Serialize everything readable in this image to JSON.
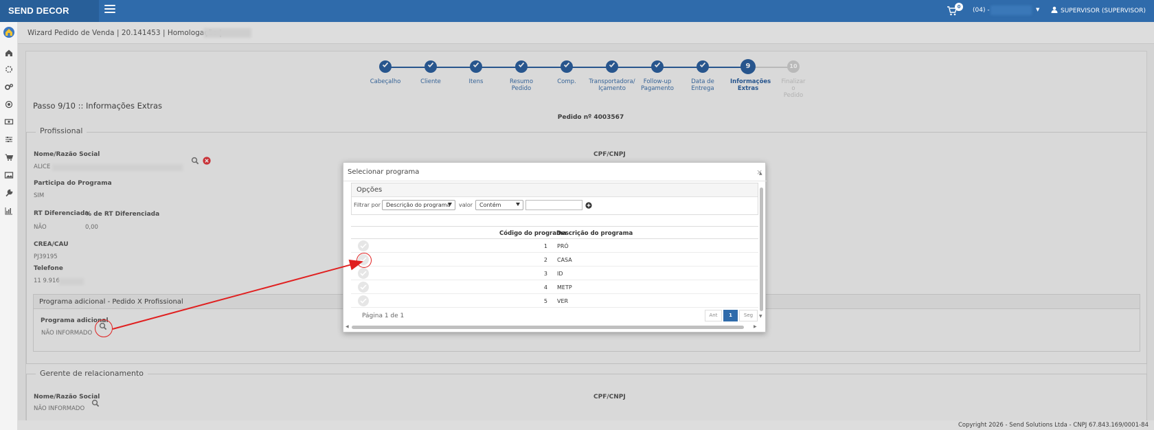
{
  "app": {
    "brand": "SEND DECOR"
  },
  "topbar": {
    "cart_count": "0",
    "store": "(04) -",
    "user": "SUPERVISOR (SUPERVISOR)"
  },
  "header": {
    "title": "Wizard Pedido de Venda | 20.141453 | Homologação |"
  },
  "wizard": {
    "steps": [
      {
        "label": "Cabeçalho",
        "num": ""
      },
      {
        "label": "Cliente",
        "num": ""
      },
      {
        "label": "Itens",
        "num": ""
      },
      {
        "label": "Resumo Pedido",
        "num": ""
      },
      {
        "label": "Comp.",
        "num": ""
      },
      {
        "label": "Transportadora/ Içamento",
        "num": ""
      },
      {
        "label": "Follow-up Pagamento",
        "num": ""
      },
      {
        "label": "Data de Entrega",
        "num": ""
      },
      {
        "label": "Informações Extras",
        "num": "9"
      },
      {
        "label": "Finalizar o Pedido",
        "num": "10"
      }
    ]
  },
  "page": {
    "passo": "Passo 9/10 :: Informações Extras",
    "pedido": "Pedido nº 4003567"
  },
  "profissional": {
    "legend": "Profissional",
    "nome_label": "Nome/Razão Social",
    "nome_value": "ALICE",
    "cpf_label": "CPF/CNPJ",
    "participa_label": "Participa do Programa",
    "participa_value": "SIM",
    "rt_label": "RT Diferenciada",
    "rt_value": "NÃO",
    "pct_rt_label": "% de RT Diferenciada",
    "pct_rt_value": "0,00",
    "crea_label": "CREA/CAU",
    "crea_value": "PJ39195",
    "telefone_label": "Telefone",
    "telefone_value": "11 9.916"
  },
  "programa_adicional": {
    "title": "Programa adicional - Pedido X Profissional",
    "label": "Programa adicional",
    "value": "NÃO INFORMADO"
  },
  "gerente": {
    "legend": "Gerente de relacionamento",
    "nome_label": "Nome/Razão Social",
    "nome_value": "NÃO INFORMADO",
    "cpf_label": "CPF/CNPJ"
  },
  "modal": {
    "title": "Selecionar programa",
    "close": "×",
    "opcoes": "Opções",
    "filtrar_label": "Filtrar por",
    "filtrar_value": "Descrição do programa",
    "valor_label": "valor",
    "operador_value": "Contém",
    "search_value": "",
    "columns": {
      "code": "Código do programa",
      "desc": "Descrição do programa"
    },
    "rows": [
      {
        "code": "1",
        "desc": "PRÓ"
      },
      {
        "code": "2",
        "desc": "CASA"
      },
      {
        "code": "3",
        "desc": "ID"
      },
      {
        "code": "4",
        "desc": "METP"
      },
      {
        "code": "5",
        "desc": "VER"
      }
    ],
    "pagination": {
      "text": "Página 1 de 1",
      "prev": "Ant",
      "current": "1",
      "next": "Seg"
    }
  },
  "footer": {
    "copyright": "Copyright 2026 - Send Solutions Ltda - CNPJ 67.843.169/0001-84"
  },
  "colors": {
    "primary": "#2f6bab",
    "annotation": "#e02020",
    "danger": "#e0383e"
  }
}
